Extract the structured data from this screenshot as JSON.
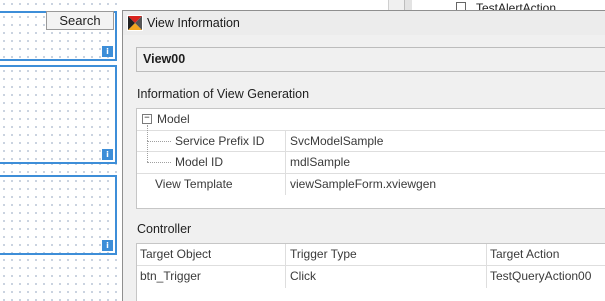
{
  "background": {
    "search_label": "Search",
    "info_glyph": "i",
    "tree_item_label": "TestAlertAction"
  },
  "popup": {
    "title": "View Information",
    "app_icon": "hourglass-app-icon",
    "view_name": "View00",
    "generation_section": {
      "label": "Information of View Generation",
      "model_group": "Model",
      "collapse_glyph": "−",
      "rows": [
        {
          "name": "Service Prefix ID",
          "value": "SvcModelSample"
        },
        {
          "name": "Model ID",
          "value": "mdlSample"
        }
      ],
      "view_template": {
        "name": "View Template",
        "value": "viewSampleForm.xviewgen"
      }
    },
    "controller_section": {
      "label": "Controller",
      "headers": [
        "Target Object",
        "Trigger Type",
        "Target Action"
      ],
      "rows": [
        [
          "btn_Trigger",
          "Click",
          "TestQueryAction00"
        ]
      ]
    }
  },
  "colors": {
    "selection_border": "#3d8ed8",
    "window_bg": "#f0f0f0",
    "grid_bg": "#ffffff"
  }
}
